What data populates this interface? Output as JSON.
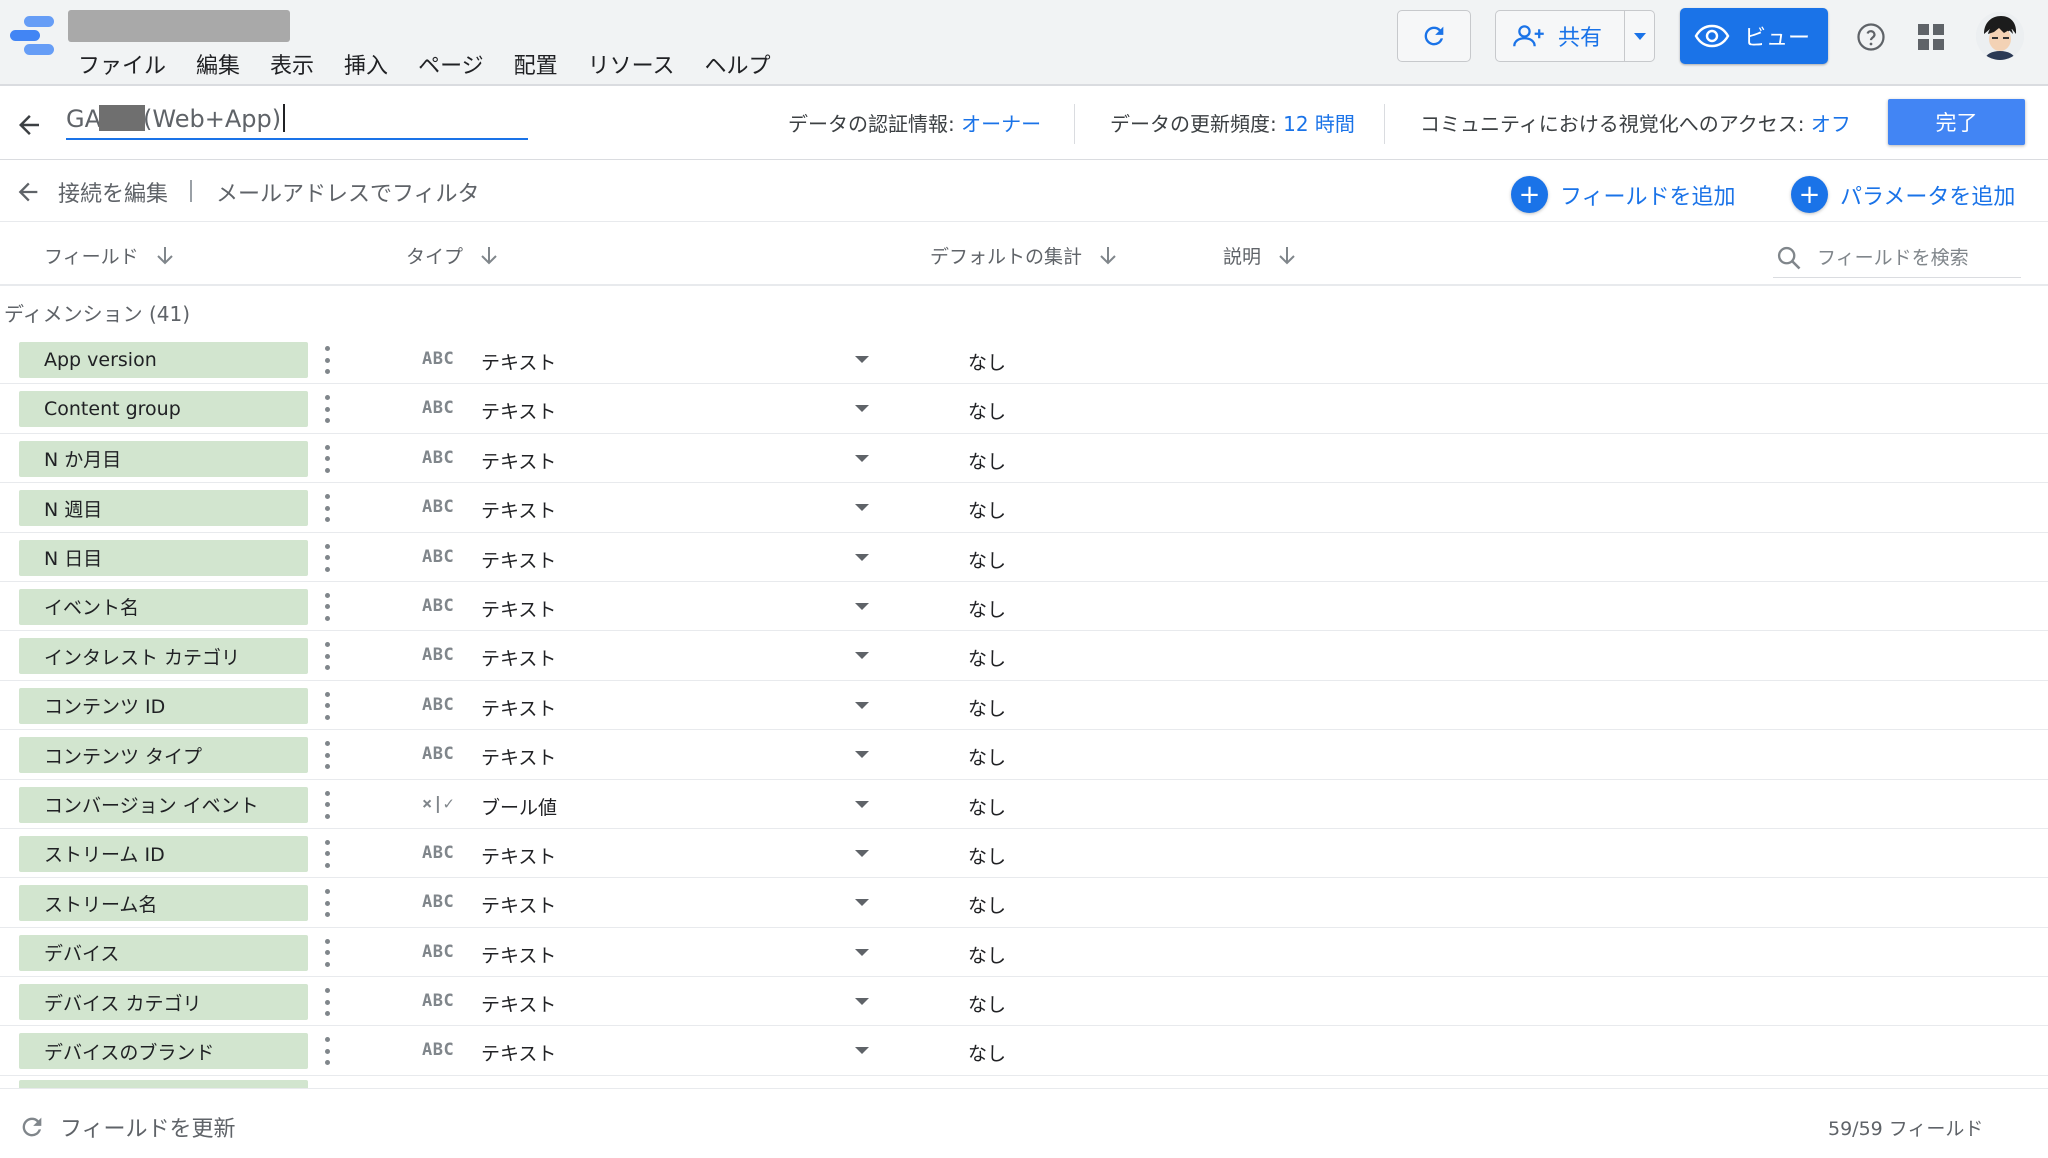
{
  "menu": [
    "ファイル",
    "編集",
    "表示",
    "挿入",
    "ページ",
    "配置",
    "リソース",
    "ヘルプ"
  ],
  "toolbar": {
    "share_label": "共有",
    "view_label": "ビュー"
  },
  "datasource": {
    "name_prefix": "GA",
    "name_suffix": "(Web+App)",
    "credentials_label": "データの認証情報:",
    "credentials_value": "オーナー",
    "freshness_label": "データの更新頻度:",
    "freshness_value": "12 時間",
    "community_label": "コミュニティにおける視覚化へのアクセス:",
    "community_value": "オフ",
    "done_label": "完了"
  },
  "connection": {
    "edit_label": "接続を編集",
    "filter_label": "メールアドレスでフィルタ",
    "add_field_label": "フィールドを追加",
    "add_param_label": "パラメータを追加"
  },
  "columns": {
    "field": "フィールド",
    "type": "タイプ",
    "aggregation": "デフォルトの集計",
    "description": "説明",
    "search_placeholder": "フィールドを検索"
  },
  "section_title": "ディメンション (41)",
  "rows": [
    {
      "name": "App version",
      "type_icon": "ABC",
      "type": "テキスト",
      "aggregation": "なし"
    },
    {
      "name": "Content group",
      "type_icon": "ABC",
      "type": "テキスト",
      "aggregation": "なし"
    },
    {
      "name": "N か月目",
      "type_icon": "ABC",
      "type": "テキスト",
      "aggregation": "なし"
    },
    {
      "name": "N 週目",
      "type_icon": "ABC",
      "type": "テキスト",
      "aggregation": "なし"
    },
    {
      "name": "N 日目",
      "type_icon": "ABC",
      "type": "テキスト",
      "aggregation": "なし"
    },
    {
      "name": "イベント名",
      "type_icon": "ABC",
      "type": "テキスト",
      "aggregation": "なし"
    },
    {
      "name": "インタレスト カテゴリ",
      "type_icon": "ABC",
      "type": "テキスト",
      "aggregation": "なし"
    },
    {
      "name": "コンテンツ ID",
      "type_icon": "ABC",
      "type": "テキスト",
      "aggregation": "なし"
    },
    {
      "name": "コンテンツ タイプ",
      "type_icon": "ABC",
      "type": "テキスト",
      "aggregation": "なし"
    },
    {
      "name": "コンバージョン イベント",
      "type_icon": "×|✓",
      "type": "ブール値",
      "aggregation": "なし"
    },
    {
      "name": "ストリーム ID",
      "type_icon": "ABC",
      "type": "テキスト",
      "aggregation": "なし"
    },
    {
      "name": "ストリーム名",
      "type_icon": "ABC",
      "type": "テキスト",
      "aggregation": "なし"
    },
    {
      "name": "デバイス",
      "type_icon": "ABC",
      "type": "テキスト",
      "aggregation": "なし"
    },
    {
      "name": "デバイス カテゴリ",
      "type_icon": "ABC",
      "type": "テキスト",
      "aggregation": "なし"
    },
    {
      "name": "デバイスのブランド",
      "type_icon": "ABC",
      "type": "テキスト",
      "aggregation": "なし"
    }
  ],
  "footer": {
    "refresh_label": "フィールドを更新",
    "count": "59/59 フィールド"
  },
  "colors": {
    "accent": "#1a73e8",
    "chip": "#d2e5cf",
    "logo_blue": "#669df6",
    "logo_dark": "#4285f4"
  },
  "icons": [
    "logo-icon",
    "refresh-icon",
    "add-person-icon",
    "eye-icon",
    "help-icon",
    "apps-grid-icon",
    "arrow-back-icon",
    "arrow-down-icon",
    "search-icon",
    "plus-icon",
    "more-vert-icon",
    "dropdown-caret-icon"
  ]
}
